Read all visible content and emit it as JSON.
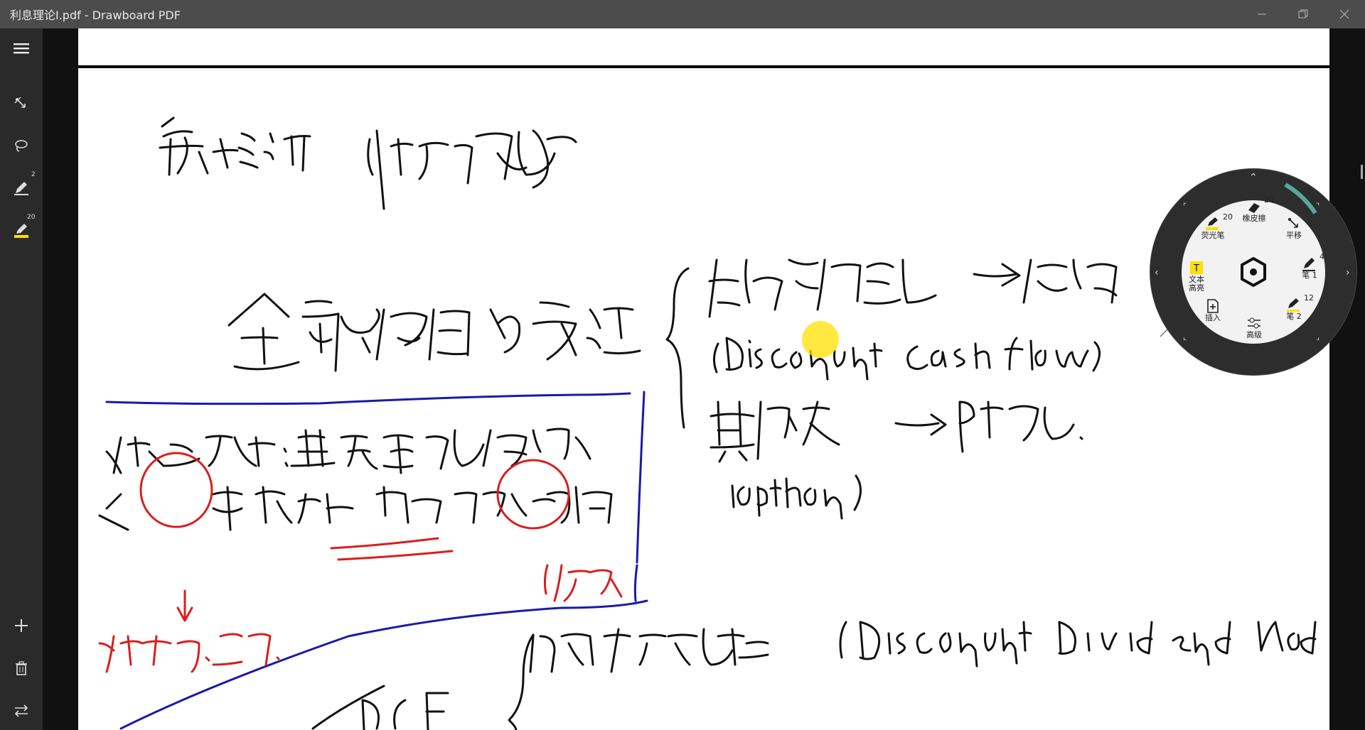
{
  "window": {
    "title": "利息理论I.pdf - Drawboard PDF"
  },
  "window_controls": {
    "minimize": "—",
    "restore": "❐",
    "close": "✕"
  },
  "sidebar": {
    "menu_icon": "hamburger-menu-icon",
    "tools": [
      {
        "name": "pan-icon",
        "badge": ""
      },
      {
        "name": "lasso-icon",
        "badge": ""
      },
      {
        "name": "pen-icon",
        "badge": "2"
      },
      {
        "name": "highlighter-icon",
        "badge": "20"
      }
    ],
    "bottom": [
      "add-icon",
      "trash-icon",
      "swap-icon"
    ]
  },
  "radial_menu": {
    "items": {
      "highlighter": {
        "label": "荧光笔",
        "num": "20"
      },
      "eraser": {
        "label": "橡皮擦",
        "num": "20"
      },
      "pan": {
        "label": "平移"
      },
      "text_highlight": {
        "label": "文本\n高亮"
      },
      "pen1": {
        "label": "笔 1",
        "num": "4"
      },
      "insert": {
        "label": "插入"
      },
      "advanced": {
        "label": "高级"
      },
      "pen2": {
        "label": "笔 2",
        "num": "12"
      }
    }
  },
  "colors": {
    "ink_black": "#111111",
    "ink_blue": "#1a1aa8",
    "ink_red": "#d81e1e",
    "highlight": "#ffe100",
    "accent": "#5aa6a0"
  }
}
